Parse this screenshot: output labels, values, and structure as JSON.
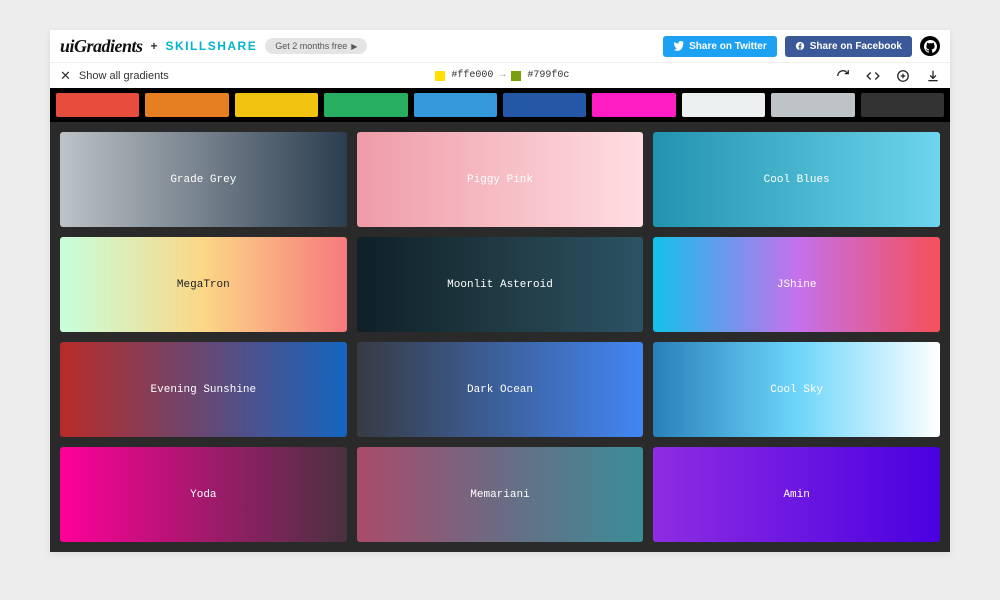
{
  "header": {
    "brand": "uiGradients",
    "plus": "+",
    "partner": "SKILLSHARE",
    "promo": "Get 2 months free",
    "share_twitter": "Share on Twitter",
    "share_facebook": "Share on Facebook"
  },
  "subbar": {
    "show_all": "Show all gradients",
    "hex1": "#ffe000",
    "hex2": "#799f0c",
    "swatch1": "#ffe000",
    "swatch2": "#799f0c",
    "arrow": "→"
  },
  "palette": [
    "#e74c3c",
    "#e67e22",
    "#f1c40f",
    "#27ae60",
    "#3498db",
    "#2458a6",
    "#ff1cc2",
    "#ecf0f1",
    "#bdc3c7",
    "#333333"
  ],
  "gradients": [
    {
      "name": "Grade Grey",
      "c1": "#bdc3c7",
      "c2": "#2c3e50",
      "text": "light"
    },
    {
      "name": "Piggy Pink",
      "c1": "#ee9ca7",
      "c2": "#ffdde1",
      "text": "light"
    },
    {
      "name": "Cool Blues",
      "c1": "#2193b0",
      "c2": "#6dd5ed",
      "text": "light"
    },
    {
      "name": "MegaTron",
      "c1": "#c6ffdd",
      "c2": "#fbd786",
      "c3": "#f7797d",
      "text": "dark"
    },
    {
      "name": "Moonlit Asteroid",
      "c1": "#0f2027",
      "c2": "#203a43",
      "c3": "#2c5364",
      "text": "light"
    },
    {
      "name": "JShine",
      "c1": "#12c2e9",
      "c2": "#c471ed",
      "c3": "#f64f59",
      "text": "light"
    },
    {
      "name": "Evening Sunshine",
      "c1": "#b92b27",
      "c2": "#1565c0",
      "text": "light"
    },
    {
      "name": "Dark Ocean",
      "c1": "#373b44",
      "c2": "#4286f4",
      "text": "light"
    },
    {
      "name": "Cool Sky",
      "c1": "#2980b9",
      "c2": "#6dd5fa",
      "c3": "#ffffff",
      "text": "light"
    },
    {
      "name": "Yoda",
      "c1": "#ff0099",
      "c2": "#493240",
      "text": "light"
    },
    {
      "name": "Memariani",
      "c1": "#aa4b6b",
      "c2": "#6b6b83",
      "c3": "#3b8d99",
      "text": "light"
    },
    {
      "name": "Amin",
      "c1": "#8e2de2",
      "c2": "#4a00e0",
      "text": "light"
    }
  ]
}
